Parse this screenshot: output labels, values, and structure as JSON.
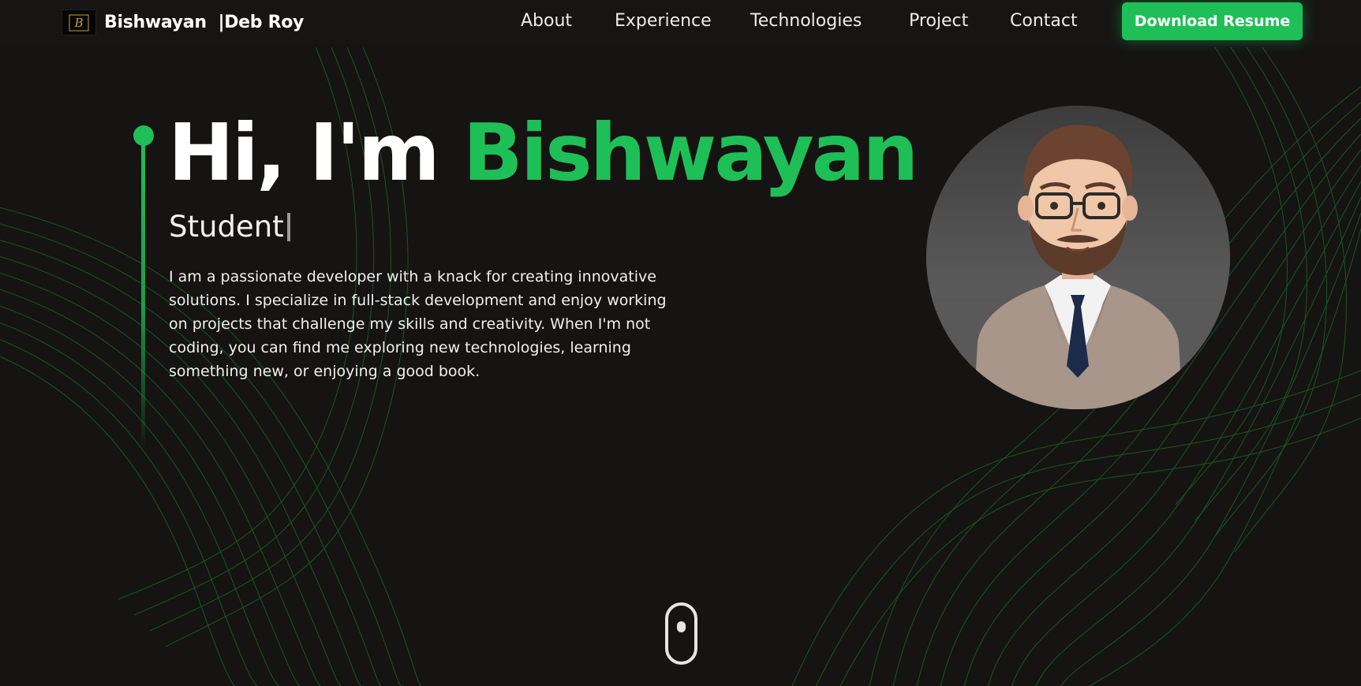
{
  "brand": {
    "logo_letter": "B",
    "name": "Bishwayan",
    "separator": "|",
    "surname": "Deb Roy"
  },
  "nav": {
    "items": [
      {
        "label": "About"
      },
      {
        "label": "Experience"
      },
      {
        "label": "Technologies"
      },
      {
        "label": "Project"
      },
      {
        "label": "Contact"
      }
    ],
    "resume_button": "Download Resume"
  },
  "hero": {
    "greeting": "Hi, I'm",
    "name": "Bishwayan",
    "role": "Student",
    "bio": "I am a passionate developer with a knack for creating innovative solutions. I specialize in full-stack development and enjoy working on projects that challenge my skills and creativity. When I'm not coding, you can find me exploring new technologies, learning something new, or enjoying a good book."
  },
  "colors": {
    "accent": "#1fbf57",
    "background": "#151412",
    "text": "#ffffff"
  },
  "icons": {
    "scroll": "mouse-scroll-icon",
    "avatar": "avatar-illustration"
  }
}
